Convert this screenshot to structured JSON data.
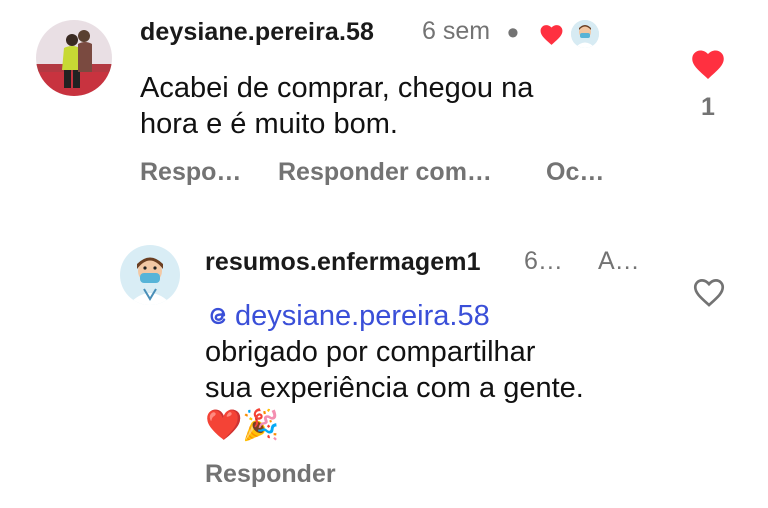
{
  "comment": {
    "username": "deysiane.pereira.58",
    "time": "6 sem",
    "dot": "•",
    "text_line1": "Acabei de comprar, chegou na",
    "text_line2": "hora e é muito bom.",
    "actions": [
      "Respo…",
      "Responder com…",
      "Oc…"
    ],
    "like_count": "1",
    "liked": true,
    "accent_color": "#ff3040"
  },
  "reply": {
    "username": "resumos.enfermagem1",
    "time": "6…",
    "extra": "A…",
    "mention": "deysiane.pereira.58",
    "text_line1": "obrigado por compartilhar",
    "text_line2": "sua experiência com a gente.",
    "emojis": "❤️🎉",
    "actions": [
      "Responder"
    ],
    "liked": false,
    "mention_color": "#3a4fd8"
  }
}
